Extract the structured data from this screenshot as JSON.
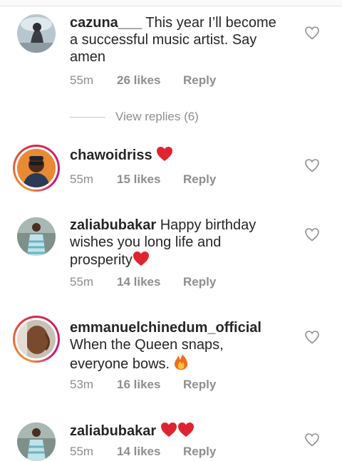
{
  "comments": [
    {
      "username": "cazuna___",
      "text": " This year I’ll become a successful music artist. Say amen",
      "time": "55m",
      "likes": "26 likes",
      "reply": "Reply"
    },
    {
      "username": "chawoidriss",
      "text": " ",
      "time": "55m",
      "likes": "15 likes",
      "reply": "Reply"
    },
    {
      "username": "zaliabubakar",
      "text": " Happy birthday wishes you long life and prosperity",
      "time": "55m",
      "likes": "14 likes",
      "reply": "Reply"
    },
    {
      "username": "emmanuelchinedum_official",
      "text": "When the Queen snaps, everyone bows. ",
      "time": "53m",
      "likes": "16 likes",
      "reply": "Reply"
    },
    {
      "username": "zaliabubakar",
      "text": " ",
      "time": "55m",
      "likes": "14 likes",
      "reply": "Reply"
    }
  ],
  "view_replies": "View replies (6)",
  "colors": {
    "heart_red": "#e0242f",
    "muted": "#8e8e8e",
    "fire": "#f26a1b"
  }
}
